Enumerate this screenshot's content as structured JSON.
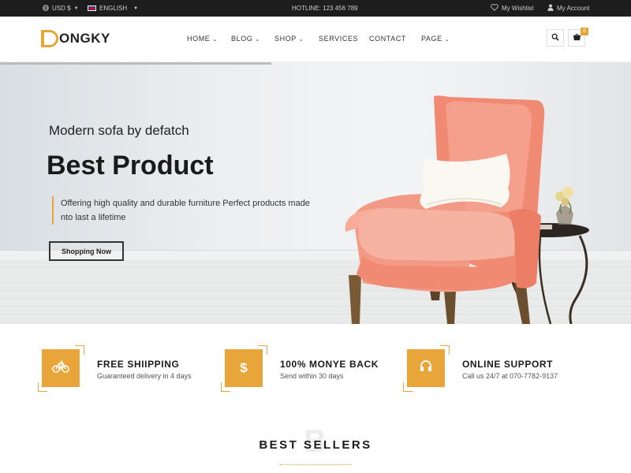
{
  "topbar": {
    "currency": "USD $",
    "language": "ENGLISH",
    "hotline": "HOTLINE: 123 456 789",
    "wishlist": "My Wishlist",
    "account": "My Account"
  },
  "header": {
    "logo_text": "ONGKY",
    "nav": [
      "HOME",
      "BLOG",
      "SHOP",
      "SERVICES",
      "CONTACT",
      "PAGE"
    ],
    "cart_count": "0"
  },
  "hero": {
    "subtitle": "Modern sofa by defatch",
    "title": "Best Product",
    "description": "Offering high quality and durable furniture Perfect products made nto last a lifetime",
    "button": "Shopping Now",
    "slider_progress": 0.43
  },
  "features": [
    {
      "icon": "bicycle-icon",
      "title": "FREE SHIIPPING",
      "desc": "Guaranteed delivery in 4 days"
    },
    {
      "icon": "dollar-icon",
      "title": "100% MONYE BACK",
      "desc": "Send within 30 days"
    },
    {
      "icon": "headset-icon",
      "title": "ONLINE SUPPORT",
      "desc": "Call us 24/7 at 070-7782-9137"
    }
  ],
  "best_sellers": {
    "bg_letter": "B",
    "title": "BEST SELLERS"
  },
  "colors": {
    "accent": "#e8a63a",
    "topbar": "#1d1d1d",
    "chair": "#f29a86"
  }
}
